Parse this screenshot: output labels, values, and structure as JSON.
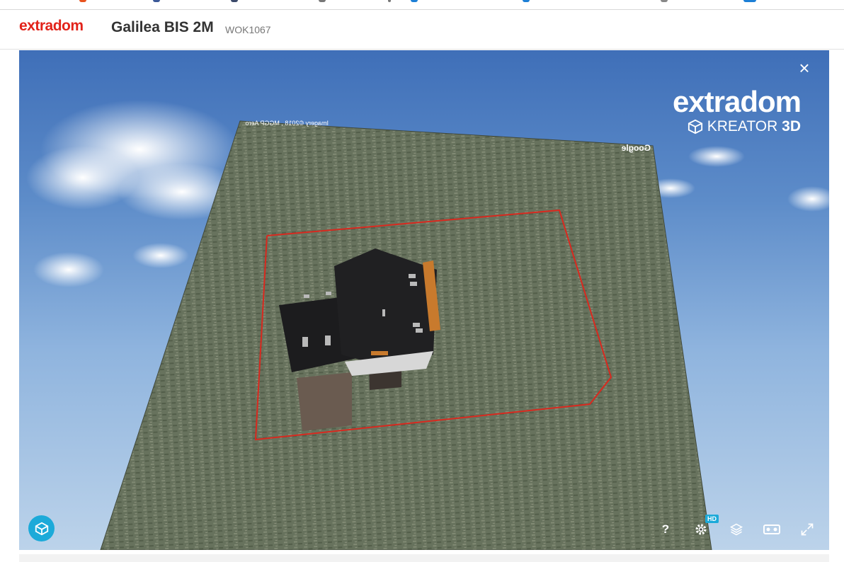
{
  "colors": {
    "brand": "#e2231a",
    "title": "#333333",
    "accent": "#1caad9",
    "plot_line": "#d9291f"
  },
  "header": {
    "brand": "extradom",
    "title": "Galilea BIS 2M",
    "code": "WOK1067"
  },
  "viewer": {
    "close_icon": "close-icon",
    "logo": {
      "name": "extradom",
      "product": "KREATOR",
      "product_suffix": "3D"
    },
    "map_attribution": "Imagery ©2018 , MGGP Aero",
    "map_provider": "Google",
    "controls": {
      "help": "?",
      "hd_badge": "HD",
      "settings_icon": "gear-icon",
      "layers_icon": "layers-icon",
      "vr_icon": "vr-headset-icon",
      "fullscreen_icon": "fullscreen-icon"
    },
    "sketchfab_icon": "sketchfab-icon"
  }
}
